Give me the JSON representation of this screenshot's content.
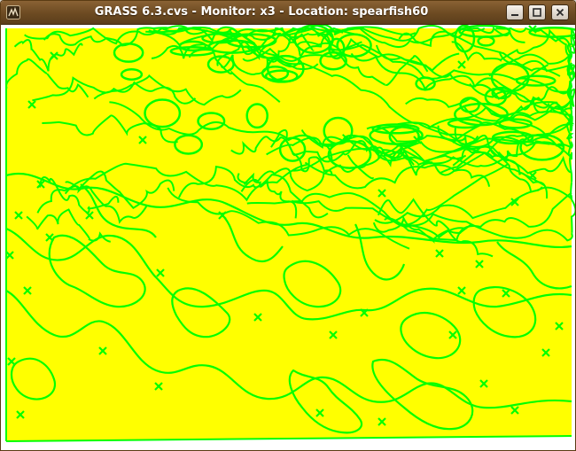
{
  "window": {
    "title": "GRASS 6.3.cvs - Monitor: x3 - Location: spearfish60"
  },
  "titlebar_buttons": {
    "minimize_icon": "minimize-icon",
    "maximize_icon": "maximize-icon",
    "close_icon": "close-icon"
  },
  "colors": {
    "titlebar": "#6c4a22",
    "raster_fill": "#ffff00",
    "vector_lines": "#00ff00",
    "background": "#ffffff"
  },
  "map": {
    "vector_layer_color_name": "green",
    "raster_color_name": "yellow"
  }
}
